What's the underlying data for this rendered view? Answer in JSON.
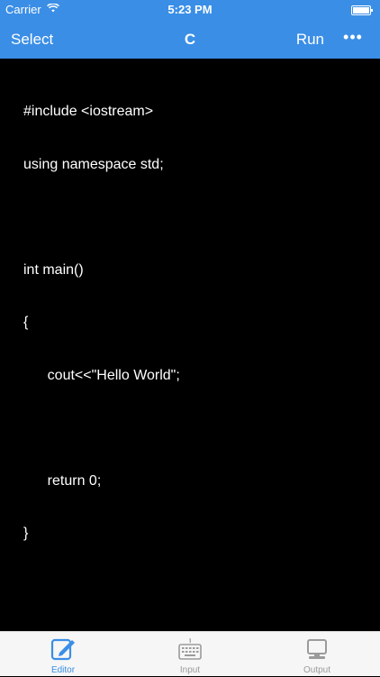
{
  "status": {
    "carrier": "Carrier",
    "time": "5:23 PM"
  },
  "navbar": {
    "left_label": "Select",
    "title": "C",
    "run_label": "Run",
    "more_label": "•••"
  },
  "editor": {
    "lines": [
      "#include <iostream>",
      "using namespace std;",
      "",
      "int main()",
      "{",
      "      cout<<\"Hello World\";",
      "",
      "      return 0;",
      "}"
    ]
  },
  "tabbar": {
    "editor": "Editor",
    "input": "Input",
    "output": "Output"
  },
  "colors": {
    "accent": "#3a8ee6",
    "editor_bg": "#000000",
    "tab_inactive": "#9b9b9b"
  }
}
